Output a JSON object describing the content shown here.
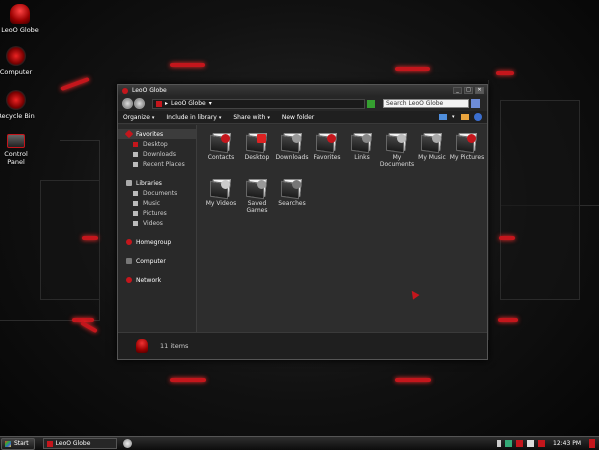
{
  "desktop": {
    "icons": [
      {
        "label": "LeoO Globe"
      },
      {
        "label": "Computer"
      },
      {
        "label": "Recycle Bin"
      },
      {
        "label": "Control Panel"
      }
    ]
  },
  "window": {
    "title": "LeoO Globe",
    "address": "LeoO Globe",
    "search_placeholder": "Search LeoO Globe",
    "toolbar": {
      "organize": "Organize",
      "include": "Include in library",
      "share": "Share with",
      "new_folder": "New folder"
    },
    "nav": {
      "favorites": {
        "label": "Favorites",
        "items": [
          "Desktop",
          "Downloads",
          "Recent Places"
        ]
      },
      "libraries": {
        "label": "Libraries",
        "items": [
          "Documents",
          "Music",
          "Pictures",
          "Videos"
        ]
      },
      "homegroup": "Homegroup",
      "computer": "Computer",
      "network": "Network"
    },
    "files": [
      "Contacts",
      "Desktop",
      "Downloads",
      "Favorites",
      "Links",
      "My Documents",
      "My Music",
      "My Pictures",
      "My Videos",
      "Saved Games",
      "Searches"
    ],
    "status": "11 items"
  },
  "taskbar": {
    "start": "Start",
    "item": "LeoO Globe",
    "clock": "12:43 PM"
  },
  "colors": {
    "accent": "#c4161c",
    "window_bg": "#2d2d2d",
    "nav_bg": "#292929"
  }
}
